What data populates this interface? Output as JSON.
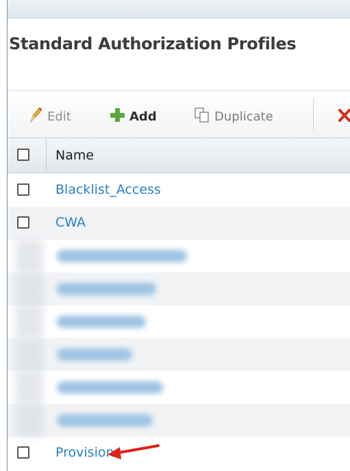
{
  "page": {
    "title": "Standard Authorization Profiles"
  },
  "toolbar": {
    "edit_label": "Edit",
    "add_label": "Add",
    "duplicate_label": "Duplicate",
    "edit_icon": "pencil-icon",
    "add_icon": "plus-icon",
    "duplicate_icon": "duplicate-icon",
    "delete_icon": "x-icon"
  },
  "table": {
    "columns": [
      "Name"
    ],
    "rows": [
      {
        "name": "Blacklist_Access",
        "checked": false
      },
      {
        "name": "CWA",
        "checked": false
      },
      {
        "name": "",
        "blurred": true
      },
      {
        "name": "",
        "blurred": true
      },
      {
        "name": "",
        "blurred": true
      },
      {
        "name": "",
        "blurred": true
      },
      {
        "name": "",
        "blurred": true
      },
      {
        "name": "",
        "blurred": true
      },
      {
        "name": "Provision",
        "checked": false
      }
    ]
  },
  "colors": {
    "link": "#2a7fc4",
    "add_plus": "#5aa83a",
    "delete_x": "#d0301c",
    "annotation_arrow": "#e0201c"
  }
}
